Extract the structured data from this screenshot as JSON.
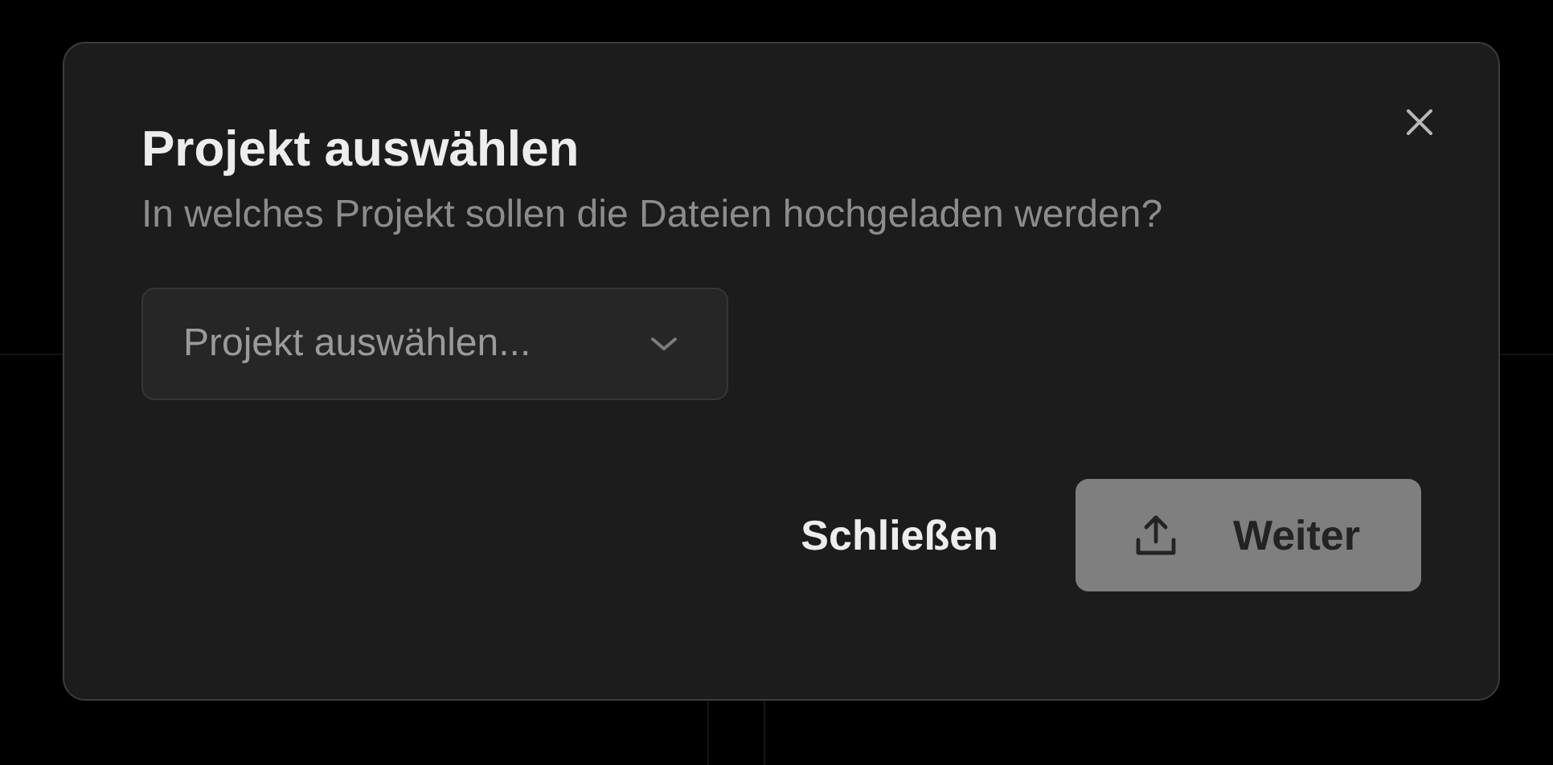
{
  "dialog": {
    "title": "Projekt auswählen",
    "description": "In welches Projekt sollen die Dateien hochgeladen werden?",
    "select": {
      "placeholder": "Projekt auswählen..."
    },
    "buttons": [
      {
        "kind": "text",
        "label": "Schließen",
        "disabled": false
      },
      {
        "kind": "upload",
        "label": "Weiter",
        "disabled": true
      }
    ]
  }
}
